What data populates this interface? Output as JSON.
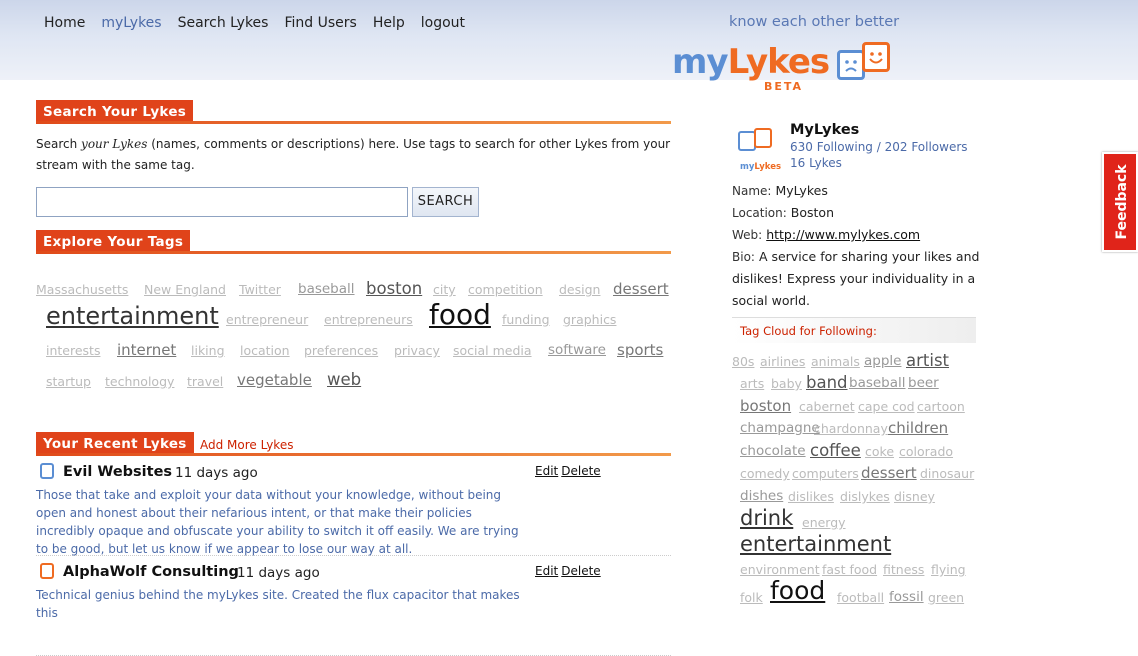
{
  "nav": {
    "home": "Home",
    "mylykes": "myLykes",
    "search": "Search Lykes",
    "find_users": "Find Users",
    "help": "Help",
    "logout": "logout"
  },
  "header": {
    "tagline": "know each other better",
    "logo_my": "my",
    "logo_lykes": "Lykes",
    "logo_beta": "BETA"
  },
  "search_section": {
    "title": "Search Your Lykes",
    "desc_prefix": "Search ",
    "desc_italic": "your Lykes",
    "desc_suffix": " (names, comments or descriptions) here. Use tags to search for other Lykes from your stream with the same tag.",
    "input_value": "",
    "button": "SEARCH"
  },
  "tags_section": {
    "title": "Explore Your Tags",
    "tags": [
      "Massachusetts",
      "New England",
      "Twitter",
      "baseball",
      "boston",
      "city",
      "competition",
      "design",
      "dessert",
      "entertainment",
      "entrepreneur",
      "entrepreneurs",
      "food",
      "funding",
      "graphics",
      "interests",
      "internet",
      "liking",
      "location",
      "preferences",
      "privacy",
      "social media",
      "software",
      "sports",
      "startup",
      "technology",
      "travel",
      "vegetable",
      "web"
    ]
  },
  "recent_section": {
    "title": "Your Recent Lykes",
    "add_more": "Add More Lykes",
    "items": [
      {
        "name": "Evil Websites",
        "time": "11 days ago",
        "edit": "Edit",
        "delete": "Delete",
        "desc": "Those that take and exploit your data without your knowledge, without being open and honest about their nefarious intent, or that make their policies incredibly opaque and obfuscate your ability to switch it off easily. We are trying to be good, but let us know if we appear to lose our way at all."
      },
      {
        "name": "AlphaWolf Consulting",
        "time": "11 days ago",
        "edit": "Edit",
        "delete": "Delete",
        "desc": "Technical genius behind the myLykes site. Created the flux capacitor that makes this"
      }
    ]
  },
  "profile": {
    "icon_label_my": "my",
    "icon_label_lykes": "Lykes",
    "name": "MyLykes",
    "following": "630 Following",
    "separator": " / ",
    "followers": "202 Followers",
    "lykes_count": "16 Lykes",
    "name_label": "Name:",
    "name_value": "MyLykes",
    "location_label": "Location:",
    "location_value": "Boston",
    "web_label": "Web:",
    "web_value": "http://www.mylykes.com",
    "bio_label": "Bio:",
    "bio_value": "A service for sharing your likes and dislikes! Express your individuality in a social world."
  },
  "following_cloud": {
    "title": "Tag Cloud for Following:",
    "tags": [
      "80s",
      "airlines",
      "animals",
      "apple",
      "artist",
      "arts",
      "baby",
      "band",
      "baseball",
      "beer",
      "boston",
      "cabernet",
      "cape cod",
      "cartoon",
      "champagne",
      "chardonnay",
      "children",
      "chocolate",
      "coffee",
      "coke",
      "colorado",
      "comedy",
      "computers",
      "dessert",
      "dinosaur",
      "dishes",
      "dislikes",
      "dislykes",
      "disney",
      "drink",
      "energy",
      "entertainment",
      "environment",
      "fast food",
      "fitness",
      "flying",
      "folk",
      "food",
      "football",
      "fossil",
      "green"
    ]
  },
  "feedback": "Feedback",
  "colors": {
    "accent": "#e0431a",
    "link_blue": "#4b6aa8",
    "brand_blue": "#5b8ed3",
    "brand_orange": "#ef6b22"
  }
}
